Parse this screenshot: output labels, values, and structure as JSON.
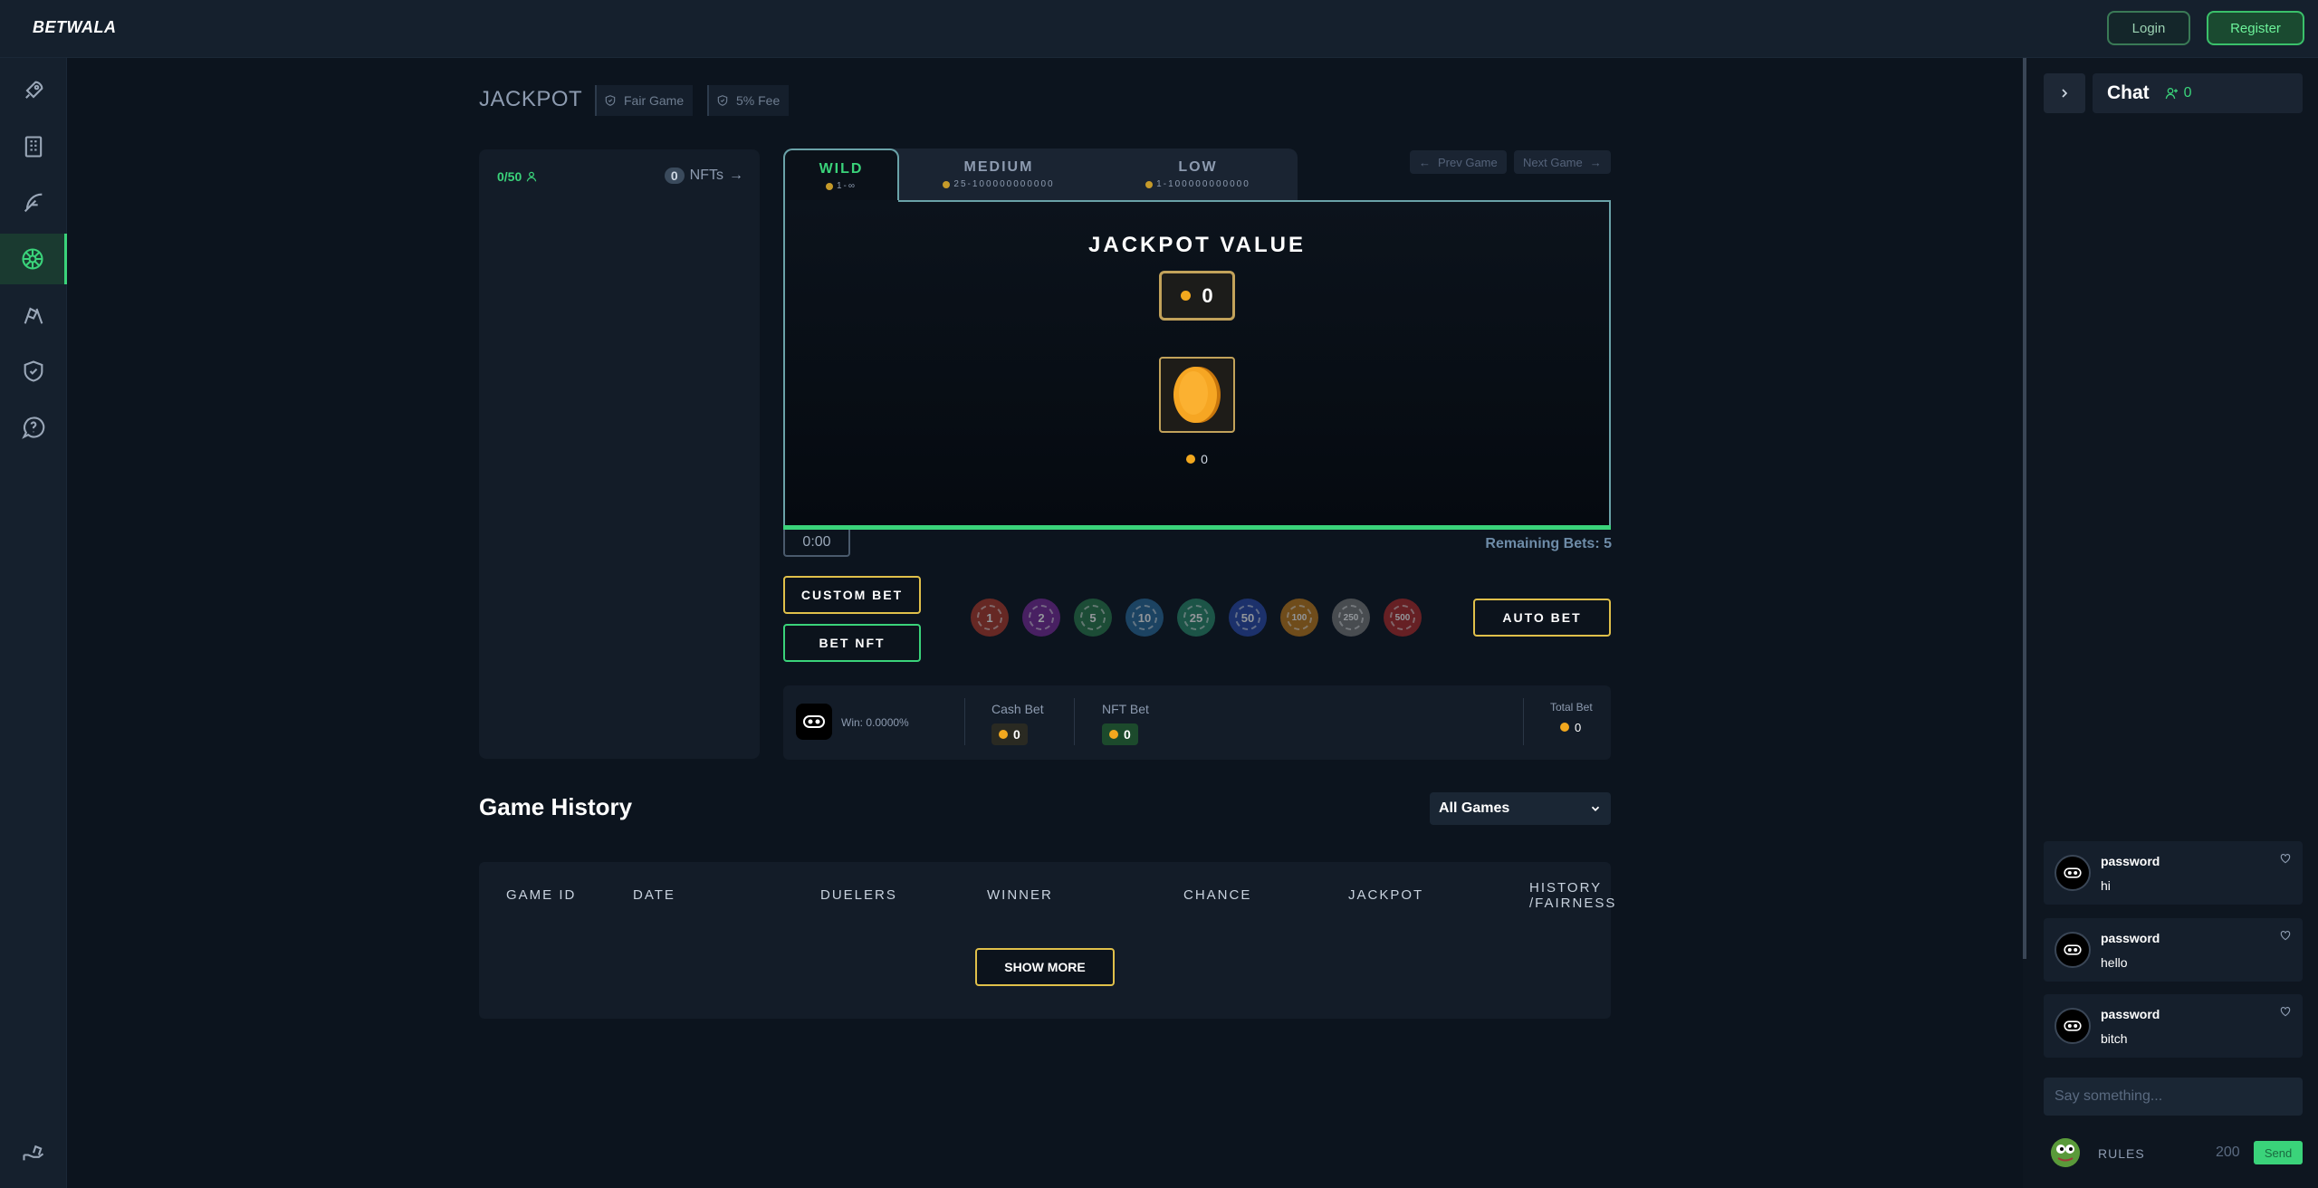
{
  "header": {
    "logo": "BETWALA",
    "login_label": "Login",
    "register_label": "Register"
  },
  "sidebar": {
    "items": [
      {
        "icon": "rocket-icon"
      },
      {
        "icon": "building-icon"
      },
      {
        "icon": "feather-icon"
      },
      {
        "icon": "wheel-icon",
        "active": true
      },
      {
        "icon": "race-flags-icon"
      },
      {
        "icon": "shield-icon"
      },
      {
        "icon": "chat-bubble-icon"
      },
      {
        "icon": "hand-coin-icon"
      }
    ]
  },
  "game": {
    "title": "JACKPOT",
    "tags": [
      "Fair Game",
      "5% Fee"
    ],
    "players": "0/50",
    "nft_count": "0",
    "nft_label": "NFTs",
    "tabs": [
      {
        "name": "WILD",
        "range": "1-∞",
        "active": true
      },
      {
        "name": "MEDIUM",
        "range": "25-100000000000",
        "active": false
      },
      {
        "name": "LOW",
        "range": "1-100000000000",
        "active": false
      }
    ],
    "prev_label": "Prev Game",
    "next_label": "Next Game",
    "jackpot_title": "JACKPOT VALUE",
    "jackpot_value": "0",
    "coin_value": "0",
    "progress": 1.0,
    "timer": "0:00",
    "remaining": "Remaining Bets: 5",
    "custom_bet_label": "CUSTOM BET",
    "bet_nft_label": "BET NFT",
    "auto_bet_label": "AUTO BET",
    "chips": [
      {
        "value": "1",
        "color": "#b03a2a"
      },
      {
        "value": "2",
        "color": "#7a2a9a"
      },
      {
        "value": "5",
        "color": "#2a7a4a"
      },
      {
        "value": "10",
        "color": "#2a6a9a"
      },
      {
        "value": "25",
        "color": "#2a8a6a"
      },
      {
        "value": "50",
        "color": "#2a4aaa"
      },
      {
        "value": "100",
        "color": "#c07a1a"
      },
      {
        "value": "250",
        "color": "#7a7a7a"
      },
      {
        "value": "500",
        "color": "#b02a2a"
      }
    ]
  },
  "summary": {
    "win": "Win: 0.0000%",
    "cash_label": "Cash Bet",
    "cash_value": "0",
    "nft_label": "NFT Bet",
    "nft_value": "0",
    "total_label": "Total Bet",
    "total_value": "0"
  },
  "history": {
    "title": "Game History",
    "filter": "All Games",
    "columns": [
      "GAME ID",
      "DATE",
      "DUELERS",
      "WINNER",
      "CHANCE",
      "JACKPOT",
      "HISTORY",
      "/FAIRNESS"
    ],
    "show_more_label": "SHOW MORE"
  },
  "chat": {
    "title": "Chat",
    "online": "0",
    "messages": [
      {
        "user": "password",
        "text": "hi"
      },
      {
        "user": "password",
        "text": "hello"
      },
      {
        "user": "password",
        "text": "bitch"
      }
    ],
    "placeholder": "Say something...",
    "rules_label": "RULES",
    "char_count": "200",
    "send_label": "Send"
  },
  "colors": {
    "accent_green": "#3ad37a",
    "accent_gold": "#e0c04a",
    "background": "#0c141e"
  }
}
